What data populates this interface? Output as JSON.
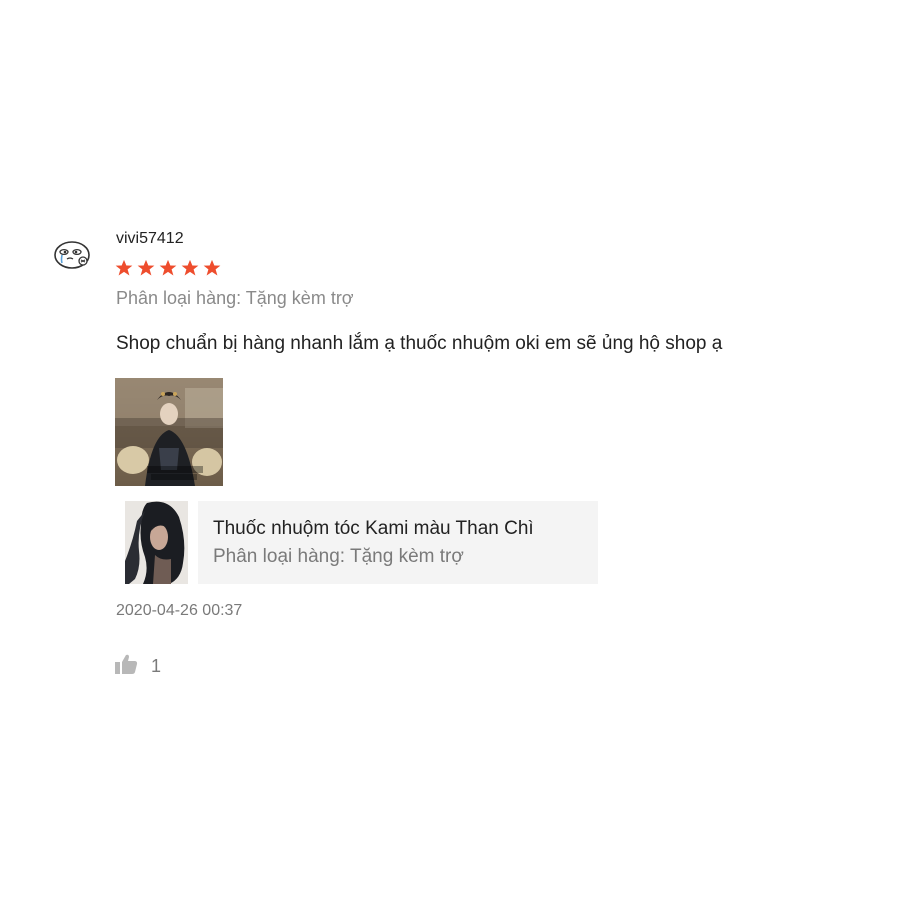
{
  "review": {
    "username": "vivi57412",
    "rating": 5,
    "variation": "Phân loại hàng: Tặng kèm trợ",
    "comment": "Shop chuẩn bị hàng nhanh lắm ạ thuốc nhuộm oki em sẽ ủng hộ shop ạ",
    "timestamp": "2020-04-26 00:37",
    "likes": "1"
  },
  "product": {
    "name": "Thuốc nhuộm tóc Kami màu Than Chì",
    "variation": "Phân loại hàng: Tặng kèm trợ"
  },
  "colors": {
    "star": "#ee4d2d",
    "muted_text": "#7a7a7a",
    "card_bg": "#f4f4f4"
  },
  "icons": {
    "avatar": "crying-face-avatar",
    "star": "star-icon",
    "like": "thumbs-up-icon"
  }
}
